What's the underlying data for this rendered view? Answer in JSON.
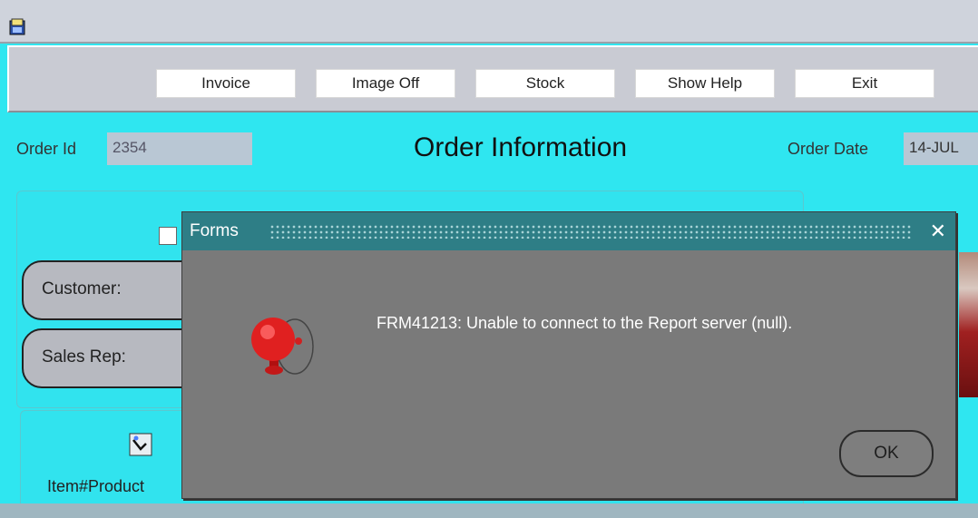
{
  "toolbar": {
    "buttons": [
      {
        "label": "Invoice"
      },
      {
        "label": "Image Off"
      },
      {
        "label": "Stock"
      },
      {
        "label": "Show Help"
      },
      {
        "label": "Exit"
      }
    ]
  },
  "form": {
    "order_id_label": "Order Id",
    "order_id_value": "2354",
    "heading": "Order Information",
    "order_date_label": "Order Date",
    "order_date_value": "14-JUL",
    "customer_label": "Customer:",
    "sales_rep_label": "Sales Rep:",
    "item_header": "Item#Product"
  },
  "dialog": {
    "title": "Forms",
    "message": "FRM41213: Unable to connect to the Report server (null).",
    "ok_label": "OK",
    "close_glyph": "✕",
    "icon": "alarm-bell-icon"
  },
  "colors": {
    "form_background": "#2fe6f0",
    "dialog_title_bar": "#2e7e86",
    "dialog_body": "#7a7a7a"
  }
}
